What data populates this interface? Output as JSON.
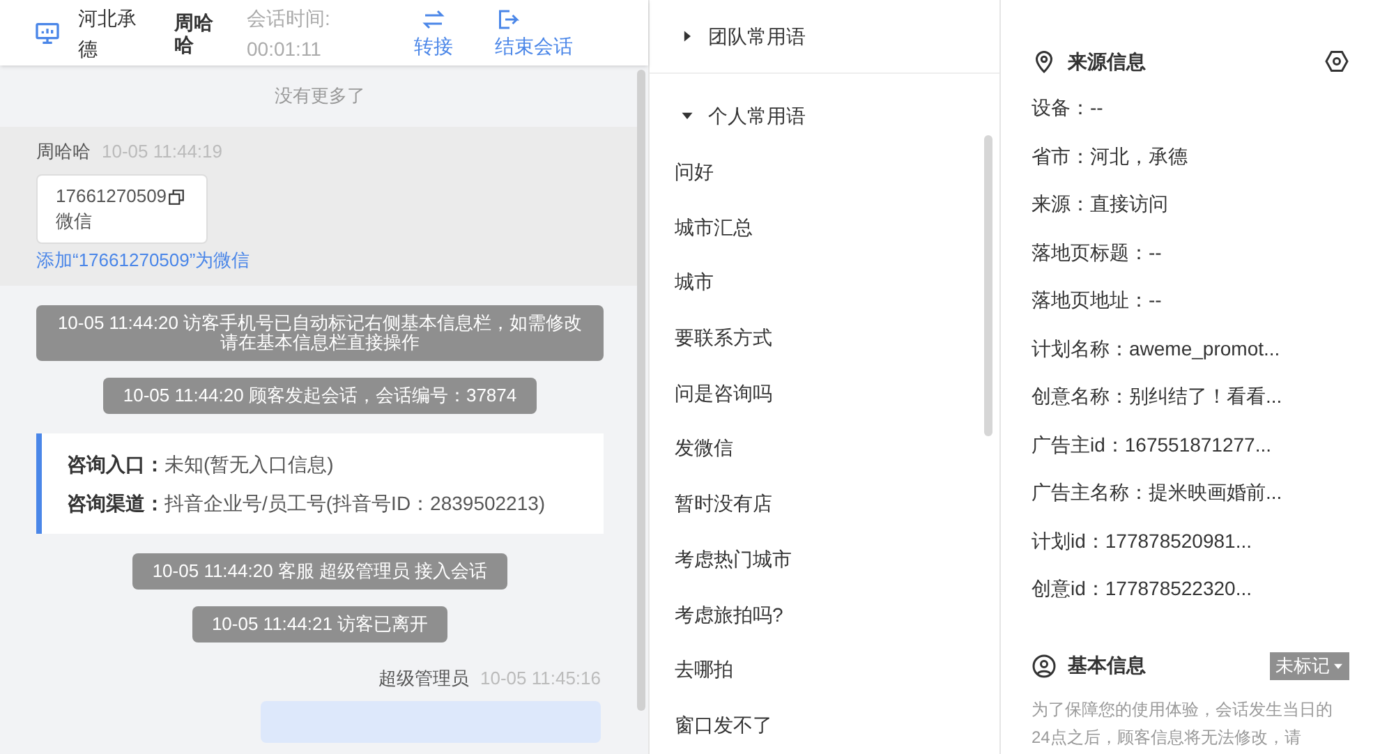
{
  "header": {
    "location": "河北承德",
    "visitor": "周哈哈",
    "timer_label": "会话时间:",
    "timer": "00:01:11",
    "actions": [
      {
        "kind": "transfer",
        "label": "转接"
      },
      {
        "kind": "end",
        "label": "结束会话"
      }
    ]
  },
  "chat": {
    "no_more": "没有更多了",
    "messages": [
      {
        "kind": "card",
        "sender": "周哈哈",
        "time": "10-05 11:44:19",
        "number": "17661270509",
        "type": "微信",
        "link": "添加“17661270509”为微信"
      },
      {
        "kind": "system",
        "text": "10-05 11:44:20 访客手机号已自动标记右侧基本信息栏，如需修改请在基本信息栏直接操作"
      },
      {
        "kind": "system",
        "text": "10-05 11:44:20 顾客发起会话，会话编号：37874"
      },
      {
        "kind": "info",
        "rows": [
          {
            "label": "咨询入口：",
            "value": "未知(暂无入口信息)"
          },
          {
            "label": "咨询渠道：",
            "value": "抖音企业号/员工号(抖音号ID：2839502213)"
          }
        ]
      },
      {
        "kind": "system",
        "text": "10-05 11:44:20 客服 超级管理员 接入会话"
      },
      {
        "kind": "system",
        "text": "10-05 11:44:21 访客已离开"
      },
      {
        "kind": "outgoing",
        "sender": "超级管理员",
        "time": "10-05 11:45:16"
      }
    ]
  },
  "phrases": {
    "groups": [
      {
        "title": "团队常用语",
        "expanded": false
      },
      {
        "title": "个人常用语",
        "expanded": true,
        "items": [
          "问好",
          "城市汇总",
          "城市",
          "要联系方式",
          "问是咨询吗",
          "发微信",
          "暂时没有店",
          "考虑热门城市",
          "考虑旅拍吗?",
          "去哪拍",
          "窗口发不了"
        ]
      }
    ]
  },
  "source_info": {
    "title": "来源信息",
    "fields": [
      "设备：--",
      "省市：河北，承德",
      "来源：直接访问",
      "落地页标题：--",
      "落地页地址：--",
      "计划名称：aweme_promot...",
      "创意名称：别纠结了！看看...",
      "广告主id：167551871277...",
      "广告主名称：提米映画婚前...",
      "计划id：177878520981...",
      "创意id：177878522320..."
    ]
  },
  "basic_info": {
    "title": "基本信息",
    "tag": "未标记",
    "notice": "为了保障您的使用体验，会话发生当日的24点之后，顾客信息将无法修改，请"
  }
}
